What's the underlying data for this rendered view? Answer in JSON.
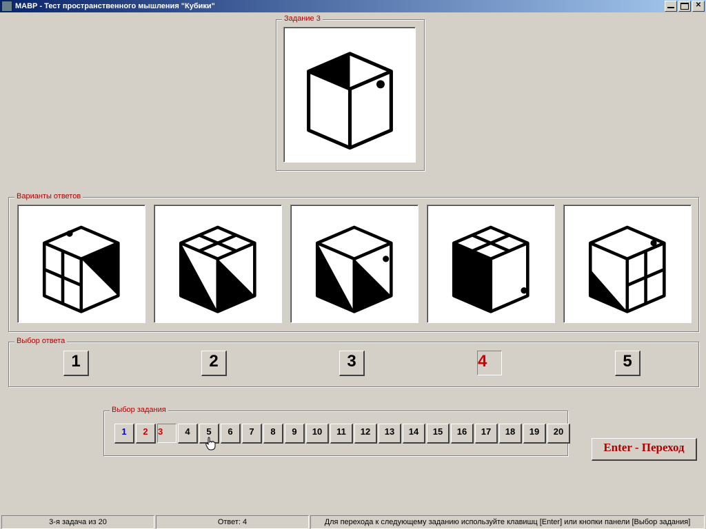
{
  "window": {
    "title": "МАВР - Тест пространственного мышления \"Кубики\""
  },
  "task_group_label": "Задание 3",
  "variants_group_label": "Варианты ответов",
  "answer_group_label": "Выбор ответа",
  "tasksel_group_label": "Выбор задания",
  "answer_buttons": [
    "1",
    "2",
    "3",
    "4",
    "5"
  ],
  "selected_answer_index": 3,
  "task_buttons": [
    "1",
    "2",
    "3",
    "4",
    "5",
    "6",
    "7",
    "8",
    "9",
    "10",
    "11",
    "12",
    "13",
    "14",
    "15",
    "16",
    "17",
    "18",
    "19",
    "20"
  ],
  "task_highlight_blue": 0,
  "task_highlight_red_prev": 1,
  "task_highlight_red_cur": 2,
  "enter_button": "Enter - Переход",
  "status": {
    "left": "3-я задача из 20",
    "mid": "Ответ: 4",
    "right": "Для перехода к следующему заданию используйте клавишц [Enter] или кнопки панели [Выбор задания]"
  }
}
